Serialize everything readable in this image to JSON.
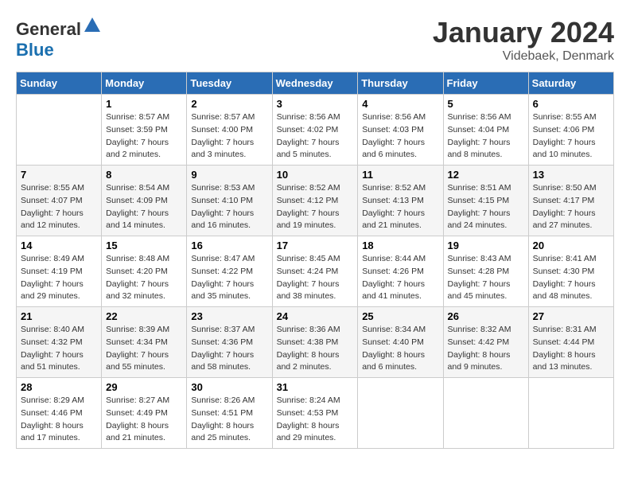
{
  "logo": {
    "general": "General",
    "blue": "Blue"
  },
  "header": {
    "month_year": "January 2024",
    "location": "Videbaek, Denmark"
  },
  "weekdays": [
    "Sunday",
    "Monday",
    "Tuesday",
    "Wednesday",
    "Thursday",
    "Friday",
    "Saturday"
  ],
  "weeks": [
    [
      {
        "day": "",
        "sunrise": "",
        "sunset": "",
        "daylight": ""
      },
      {
        "day": "1",
        "sunrise": "Sunrise: 8:57 AM",
        "sunset": "Sunset: 3:59 PM",
        "daylight": "Daylight: 7 hours and 2 minutes."
      },
      {
        "day": "2",
        "sunrise": "Sunrise: 8:57 AM",
        "sunset": "Sunset: 4:00 PM",
        "daylight": "Daylight: 7 hours and 3 minutes."
      },
      {
        "day": "3",
        "sunrise": "Sunrise: 8:56 AM",
        "sunset": "Sunset: 4:02 PM",
        "daylight": "Daylight: 7 hours and 5 minutes."
      },
      {
        "day": "4",
        "sunrise": "Sunrise: 8:56 AM",
        "sunset": "Sunset: 4:03 PM",
        "daylight": "Daylight: 7 hours and 6 minutes."
      },
      {
        "day": "5",
        "sunrise": "Sunrise: 8:56 AM",
        "sunset": "Sunset: 4:04 PM",
        "daylight": "Daylight: 7 hours and 8 minutes."
      },
      {
        "day": "6",
        "sunrise": "Sunrise: 8:55 AM",
        "sunset": "Sunset: 4:06 PM",
        "daylight": "Daylight: 7 hours and 10 minutes."
      }
    ],
    [
      {
        "day": "7",
        "sunrise": "Sunrise: 8:55 AM",
        "sunset": "Sunset: 4:07 PM",
        "daylight": "Daylight: 7 hours and 12 minutes."
      },
      {
        "day": "8",
        "sunrise": "Sunrise: 8:54 AM",
        "sunset": "Sunset: 4:09 PM",
        "daylight": "Daylight: 7 hours and 14 minutes."
      },
      {
        "day": "9",
        "sunrise": "Sunrise: 8:53 AM",
        "sunset": "Sunset: 4:10 PM",
        "daylight": "Daylight: 7 hours and 16 minutes."
      },
      {
        "day": "10",
        "sunrise": "Sunrise: 8:52 AM",
        "sunset": "Sunset: 4:12 PM",
        "daylight": "Daylight: 7 hours and 19 minutes."
      },
      {
        "day": "11",
        "sunrise": "Sunrise: 8:52 AM",
        "sunset": "Sunset: 4:13 PM",
        "daylight": "Daylight: 7 hours and 21 minutes."
      },
      {
        "day": "12",
        "sunrise": "Sunrise: 8:51 AM",
        "sunset": "Sunset: 4:15 PM",
        "daylight": "Daylight: 7 hours and 24 minutes."
      },
      {
        "day": "13",
        "sunrise": "Sunrise: 8:50 AM",
        "sunset": "Sunset: 4:17 PM",
        "daylight": "Daylight: 7 hours and 27 minutes."
      }
    ],
    [
      {
        "day": "14",
        "sunrise": "Sunrise: 8:49 AM",
        "sunset": "Sunset: 4:19 PM",
        "daylight": "Daylight: 7 hours and 29 minutes."
      },
      {
        "day": "15",
        "sunrise": "Sunrise: 8:48 AM",
        "sunset": "Sunset: 4:20 PM",
        "daylight": "Daylight: 7 hours and 32 minutes."
      },
      {
        "day": "16",
        "sunrise": "Sunrise: 8:47 AM",
        "sunset": "Sunset: 4:22 PM",
        "daylight": "Daylight: 7 hours and 35 minutes."
      },
      {
        "day": "17",
        "sunrise": "Sunrise: 8:45 AM",
        "sunset": "Sunset: 4:24 PM",
        "daylight": "Daylight: 7 hours and 38 minutes."
      },
      {
        "day": "18",
        "sunrise": "Sunrise: 8:44 AM",
        "sunset": "Sunset: 4:26 PM",
        "daylight": "Daylight: 7 hours and 41 minutes."
      },
      {
        "day": "19",
        "sunrise": "Sunrise: 8:43 AM",
        "sunset": "Sunset: 4:28 PM",
        "daylight": "Daylight: 7 hours and 45 minutes."
      },
      {
        "day": "20",
        "sunrise": "Sunrise: 8:41 AM",
        "sunset": "Sunset: 4:30 PM",
        "daylight": "Daylight: 7 hours and 48 minutes."
      }
    ],
    [
      {
        "day": "21",
        "sunrise": "Sunrise: 8:40 AM",
        "sunset": "Sunset: 4:32 PM",
        "daylight": "Daylight: 7 hours and 51 minutes."
      },
      {
        "day": "22",
        "sunrise": "Sunrise: 8:39 AM",
        "sunset": "Sunset: 4:34 PM",
        "daylight": "Daylight: 7 hours and 55 minutes."
      },
      {
        "day": "23",
        "sunrise": "Sunrise: 8:37 AM",
        "sunset": "Sunset: 4:36 PM",
        "daylight": "Daylight: 7 hours and 58 minutes."
      },
      {
        "day": "24",
        "sunrise": "Sunrise: 8:36 AM",
        "sunset": "Sunset: 4:38 PM",
        "daylight": "Daylight: 8 hours and 2 minutes."
      },
      {
        "day": "25",
        "sunrise": "Sunrise: 8:34 AM",
        "sunset": "Sunset: 4:40 PM",
        "daylight": "Daylight: 8 hours and 6 minutes."
      },
      {
        "day": "26",
        "sunrise": "Sunrise: 8:32 AM",
        "sunset": "Sunset: 4:42 PM",
        "daylight": "Daylight: 8 hours and 9 minutes."
      },
      {
        "day": "27",
        "sunrise": "Sunrise: 8:31 AM",
        "sunset": "Sunset: 4:44 PM",
        "daylight": "Daylight: 8 hours and 13 minutes."
      }
    ],
    [
      {
        "day": "28",
        "sunrise": "Sunrise: 8:29 AM",
        "sunset": "Sunset: 4:46 PM",
        "daylight": "Daylight: 8 hours and 17 minutes."
      },
      {
        "day": "29",
        "sunrise": "Sunrise: 8:27 AM",
        "sunset": "Sunset: 4:49 PM",
        "daylight": "Daylight: 8 hours and 21 minutes."
      },
      {
        "day": "30",
        "sunrise": "Sunrise: 8:26 AM",
        "sunset": "Sunset: 4:51 PM",
        "daylight": "Daylight: 8 hours and 25 minutes."
      },
      {
        "day": "31",
        "sunrise": "Sunrise: 8:24 AM",
        "sunset": "Sunset: 4:53 PM",
        "daylight": "Daylight: 8 hours and 29 minutes."
      },
      {
        "day": "",
        "sunrise": "",
        "sunset": "",
        "daylight": ""
      },
      {
        "day": "",
        "sunrise": "",
        "sunset": "",
        "daylight": ""
      },
      {
        "day": "",
        "sunrise": "",
        "sunset": "",
        "daylight": ""
      }
    ]
  ]
}
